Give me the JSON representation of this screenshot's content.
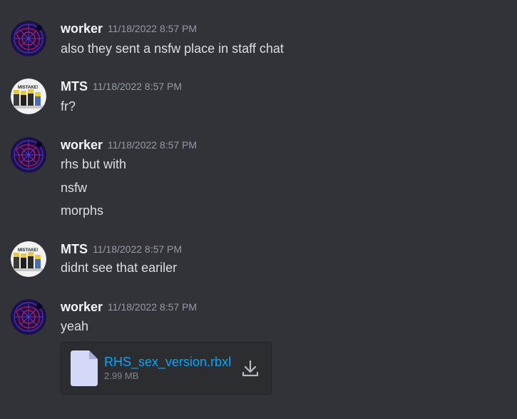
{
  "messages": [
    {
      "username": "worker",
      "timestamp": "11/18/2022 8:57 PM",
      "lines": [
        "also they sent a nsfw place in staff chat"
      ]
    },
    {
      "username": "MTS",
      "timestamp": "11/18/2022 8:57 PM",
      "lines": [
        "fr?"
      ]
    },
    {
      "username": "worker",
      "timestamp": "11/18/2022 8:57 PM",
      "lines": [
        "rhs but with",
        "nsfw",
        "morphs"
      ]
    },
    {
      "username": "MTS",
      "timestamp": "11/18/2022 8:57 PM",
      "lines": [
        "didnt see that eariler"
      ]
    },
    {
      "username": "worker",
      "timestamp": "11/18/2022 8:57 PM",
      "lines": [
        "yeah"
      ],
      "attachment": {
        "file_name": "RHS_sex_version.rbxl",
        "file_size": "2.99 MB"
      }
    }
  ],
  "colors": {
    "background": "#313338",
    "username": "#f2f3f5",
    "timestamp": "#949ba4",
    "message_text": "#dbdee1",
    "link": "#00a8fc"
  }
}
